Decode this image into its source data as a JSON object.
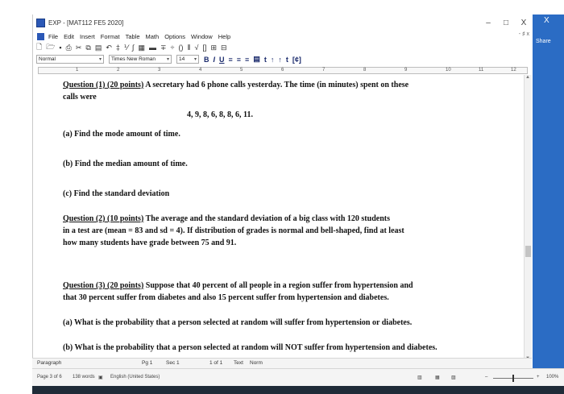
{
  "window": {
    "title": "EXP - [MAT112 FE5 2020]",
    "minimize": "–",
    "maximize": "□",
    "close": "X",
    "share": "Share"
  },
  "menu": [
    "File",
    "Edit",
    "Insert",
    "Format",
    "Table",
    "Math",
    "Options",
    "Window",
    "Help"
  ],
  "mdi": "- ♯ x",
  "toolbar": {
    "style": "Normal",
    "font": "Times New Roman",
    "size": "14",
    "bold": "B",
    "italic": "I",
    "underline": "U",
    "format_extra": "[¢]"
  },
  "ruler": [
    "1",
    "2",
    "3",
    "4",
    "5",
    "6",
    "7",
    "8",
    "9",
    "10",
    "11",
    "12"
  ],
  "document": {
    "q1_head": "Question (1) (20 points)",
    "q1_text1": " A secretary had 6 phone calls yesterday.  The time (in minutes) spent on these",
    "q1_text2": "calls were",
    "q1_data": "4,  9,  8,  6,  8,  8,  6,  11.",
    "q1_a": "(a)  Find the mode amount of time.",
    "q1_b": "(b)  Find the median amount of time.",
    "q1_c": "(c)  Find the standard deviation",
    "q2_head": "Question (2) (10 points)",
    "q2_text1": " The average and the standard deviation of a big class with 120 students",
    "q2_text2": "in a test are (mean = 83 and sd = 4).  If distribution of grades is normal and bell-shaped, find at least",
    "q2_text3": "how many students have grade between  75  and 91.",
    "q3_head": "Question (3) (20 points)",
    "q3_text1": "  Suppose that 40 percent of all people in a region suffer from  hypertension and",
    "q3_text2": "that 30 percent suffer from diabetes and also 15 percent suffer from hypertension and diabetes.",
    "q3_a": "(a)  What is the probability that a person selected at random will suffer from hypertension  or diabetes.",
    "q3_b": "(b) What is the probability that a person selected at random will NOT suffer from hypertension  and  diabetes."
  },
  "status": {
    "mode": "Paragraph",
    "page": "Pg 1",
    "section": "Sec 1",
    "of": "1 of 1",
    "text": "Text",
    "style": "Norm",
    "page_of": "Page 3 of 6",
    "words": "138 words",
    "language": "English (United States)",
    "zoom": "100%",
    "zoom_minus": "–",
    "zoom_plus": "+"
  }
}
